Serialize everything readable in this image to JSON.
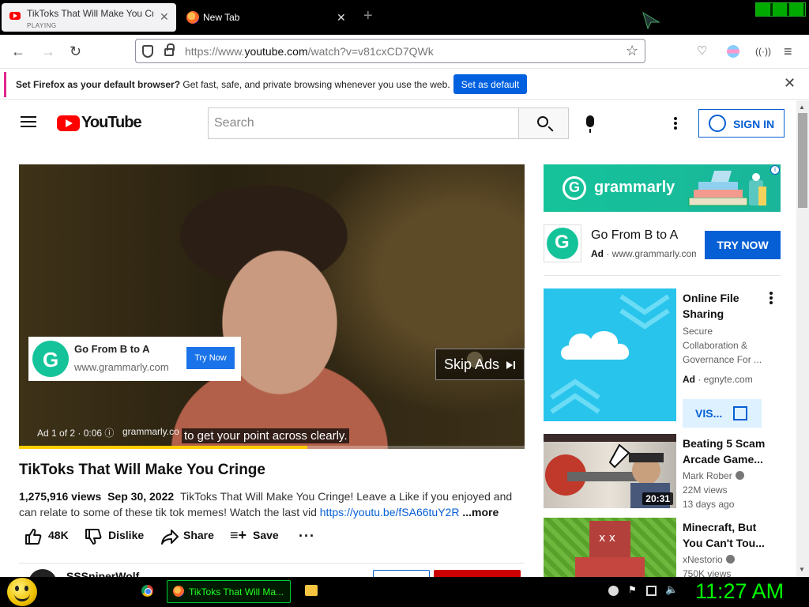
{
  "browser": {
    "tabs": [
      {
        "title": "TikToks That Will Make You Cringe",
        "subtitle": "PLAYING"
      },
      {
        "title": "New Tab"
      }
    ],
    "url_prefix": "https://www.",
    "url_host": "youtube.com",
    "url_path": "/watch?v=v81cxCD7QWk"
  },
  "notification": {
    "bold": "Set Firefox as your default browser?",
    "text": " Get fast, safe, and private browsing whenever you use the web.",
    "button": "Set as default"
  },
  "youtube": {
    "logo_text": "YouTube",
    "search_placeholder": "Search",
    "sign_in": "SIGN IN"
  },
  "player": {
    "ad_card": {
      "title": "Go From B to A",
      "domain": "www.grammarly.com",
      "button": "Try Now"
    },
    "skip_label": "Skip Ads",
    "ad_meta": "Ad 1 of 2 · 0:06 ⓘ",
    "ad_domain": "grammarly.co",
    "caption": "to get your point across clearly.",
    "progress": 0.57
  },
  "video": {
    "title": "TikToks That Will Make You Cringe",
    "views": "1,275,916 views",
    "date": "Sep 30, 2022",
    "description": "TikToks That Will Make You Cringe! Leave a Like if you enjoyed and can relate to some of these tik tok memes! Watch the last vid ",
    "link": "https://youtu.be/fSA66tuY2R",
    "more": "...more",
    "likes": "48K",
    "dislike": "Dislike",
    "share": "Share",
    "save": "Save",
    "channel": "SSSniperWolf"
  },
  "sidebar": {
    "banner_word": "grammarly",
    "ad": {
      "title": "Go From B to A",
      "ad_label": "Ad",
      "domain": " · www.grammarly.com",
      "button": "TRY NOW"
    },
    "recommendations": [
      {
        "title_l1": "Online File",
        "title_l2": "Sharing",
        "desc": "Secure Collaboration & Governance For ...",
        "ad_label": "Ad",
        "domain": " · egnyte.com",
        "button": "VIS..."
      },
      {
        "title": "Beating 5 Scam Arcade Game...",
        "channel": "Mark Rober",
        "views": "22M views",
        "age": "13 days ago",
        "duration": "20:31"
      },
      {
        "title": "Minecraft, But You Can't Tou...",
        "channel": "xNestorio",
        "views": "750K views"
      }
    ]
  },
  "taskbar": {
    "task_label": "TikToks That Will Ma...",
    "clock": "11:27 AM"
  },
  "colors": {
    "youtube_red": "#ff0000",
    "accent_blue": "#065fd4",
    "grammarly_green": "#15c39a",
    "clock_green": "#00ff00"
  }
}
